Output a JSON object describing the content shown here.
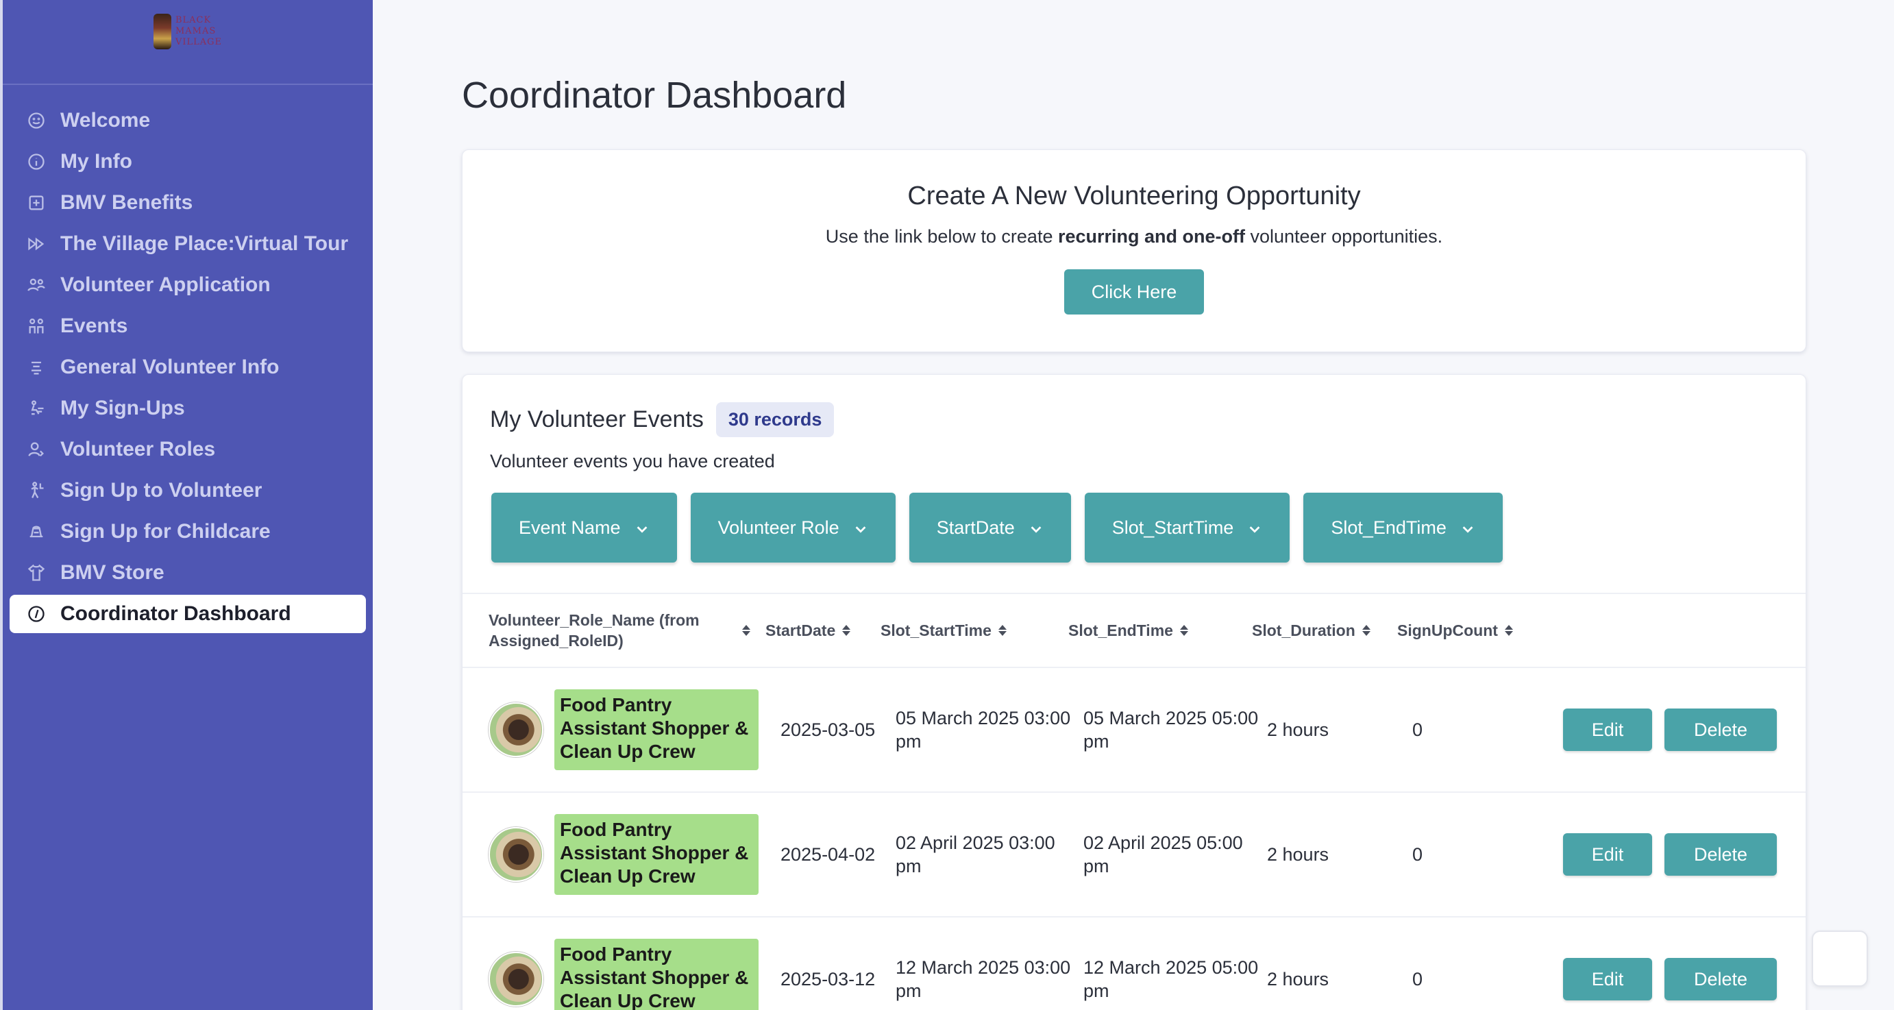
{
  "logo": {
    "lines": [
      "BLACK",
      "MAMAS",
      "VILLAGE"
    ]
  },
  "sidebar": {
    "items": [
      {
        "label": "Welcome",
        "icon": "smile-icon"
      },
      {
        "label": "My Info",
        "icon": "info-icon"
      },
      {
        "label": "BMV Benefits",
        "icon": "plus-square-icon"
      },
      {
        "label": "The Village Place:Virtual Tour",
        "icon": "fast-forward-icon"
      },
      {
        "label": "Volunteer Application",
        "icon": "users-icon"
      },
      {
        "label": "Events",
        "icon": "people-icon"
      },
      {
        "label": "General Volunteer Info",
        "icon": "list-icon"
      },
      {
        "label": "My Sign-Ups",
        "icon": "signup-icon"
      },
      {
        "label": "Volunteer Roles",
        "icon": "user-role-icon"
      },
      {
        "label": "Sign Up to Volunteer",
        "icon": "volunteer-icon"
      },
      {
        "label": "Sign Up for Childcare",
        "icon": "stroller-icon"
      },
      {
        "label": "BMV Store",
        "icon": "shirt-icon"
      },
      {
        "label": "Coordinator Dashboard",
        "icon": "compass-icon",
        "active": true
      }
    ]
  },
  "main": {
    "title": "Coordinator Dashboard",
    "create": {
      "title": "Create A New Volunteering Opportunity",
      "desc_pre": "Use the link below to create ",
      "desc_bold": "recurring and one-off",
      "desc_post": " volunteer opportunities.",
      "button": "Click Here"
    },
    "events": {
      "title": "My Volunteer Events",
      "badge": "30 records",
      "subtitle": "Volunteer events you have created",
      "filters": [
        "Event Name",
        "Volunteer Role",
        "StartDate",
        "Slot_StartTime",
        "Slot_EndTime"
      ],
      "columns": [
        "Volunteer_Role_Name (from Assigned_RoleID)",
        "StartDate",
        "Slot_StartTime",
        "Slot_EndTime",
        "Slot_Duration",
        "SignUpCount"
      ],
      "rows": [
        {
          "role": "Food Pantry Assistant Shopper & Clean Up Crew",
          "start": "2025-03-05",
          "sst": "05 March 2025 03:00 pm",
          "set": "05 March 2025 05:00 pm",
          "dur": "2 hours",
          "count": "0"
        },
        {
          "role": "Food Pantry Assistant Shopper & Clean Up Crew",
          "start": "2025-04-02",
          "sst": "02 April 2025 03:00 pm",
          "set": "02 April 2025 05:00 pm",
          "dur": "2 hours",
          "count": "0"
        },
        {
          "role": "Food Pantry Assistant Shopper & Clean Up Crew",
          "start": "2025-03-12",
          "sst": "12 March 2025 03:00 pm",
          "set": "12 March 2025 05:00 pm",
          "dur": "2 hours",
          "count": "0"
        }
      ],
      "edit_label": "Edit",
      "delete_label": "Delete"
    }
  },
  "colors": {
    "sidebar": "#4f56b3",
    "accent": "#4aa3a8",
    "tag": "#a6de8a",
    "badge_bg": "#e6e9f6"
  }
}
